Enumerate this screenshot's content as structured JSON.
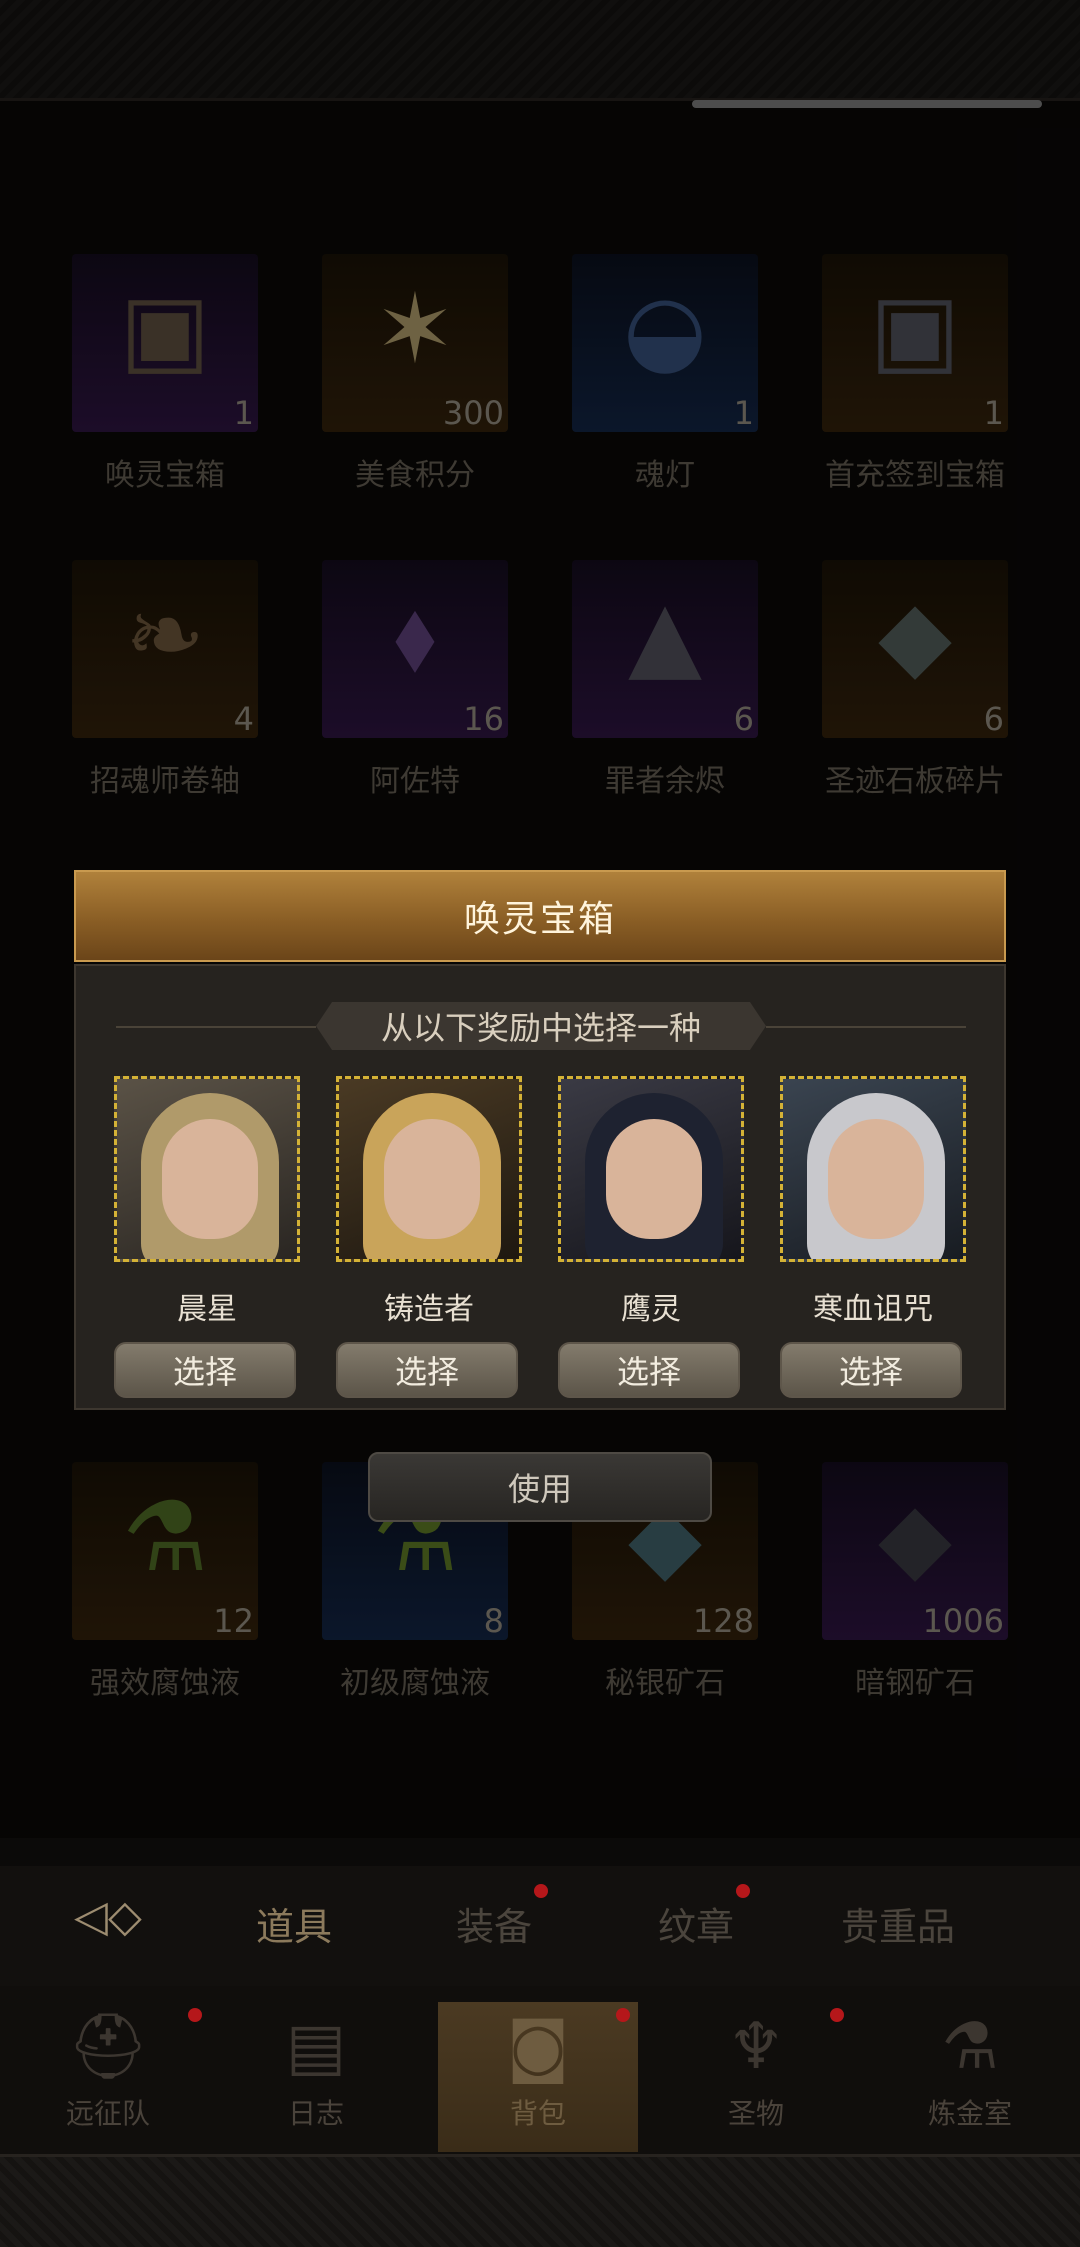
{
  "inventory": {
    "row1": [
      {
        "name": "唤灵宝箱",
        "count": "1",
        "rarity": "purple",
        "icon": "chest-icon"
      },
      {
        "name": "美食积分",
        "count": "300",
        "rarity": "orange",
        "icon": "star-icon"
      },
      {
        "name": "魂灯",
        "count": "1",
        "rarity": "blue",
        "icon": "lamp-icon"
      },
      {
        "name": "首充签到宝箱",
        "count": "1",
        "rarity": "orange",
        "icon": "chest-icon"
      }
    ],
    "row2": [
      {
        "name": "招魂师卷轴",
        "count": "4",
        "rarity": "orange",
        "icon": "scroll-icon"
      },
      {
        "name": "阿佐特",
        "count": "16",
        "rarity": "purple",
        "icon": "crystal-icon"
      },
      {
        "name": "罪者余烬",
        "count": "6",
        "rarity": "purple",
        "icon": "ember-icon"
      },
      {
        "name": "圣迹石板碎片",
        "count": "6",
        "rarity": "orange",
        "icon": "stone-icon"
      }
    ],
    "row3": [
      {
        "name": "强效腐蚀液",
        "count": "12",
        "rarity": "orange",
        "icon": "potion-icon"
      },
      {
        "name": "初级腐蚀液",
        "count": "8",
        "rarity": "blue",
        "icon": "potion-icon"
      },
      {
        "name": "秘银矿石",
        "count": "128",
        "rarity": "orange",
        "icon": "ore-icon"
      },
      {
        "name": "暗钢矿石",
        "count": "1006",
        "rarity": "purple",
        "icon": "ore-icon"
      }
    ]
  },
  "modal": {
    "title": "唤灵宝箱",
    "subtitle": "从以下奖励中选择一种",
    "choices": [
      {
        "name": "晨星",
        "button": "选择"
      },
      {
        "name": "铸造者",
        "button": "选择"
      },
      {
        "name": "鹰灵",
        "button": "选择"
      },
      {
        "name": "寒血诅咒",
        "button": "选择"
      }
    ]
  },
  "use_button": "使用",
  "tabs": {
    "items": [
      {
        "label": "道具",
        "active": true,
        "badge": false
      },
      {
        "label": "装备",
        "active": false,
        "badge": true
      },
      {
        "label": "纹章",
        "active": false,
        "badge": true
      },
      {
        "label": "贵重品",
        "active": false,
        "badge": false
      }
    ]
  },
  "bottom_nav": {
    "items": [
      {
        "label": "远征队",
        "icon": "helmet-icon",
        "badge": true
      },
      {
        "label": "日志",
        "icon": "map-icon",
        "badge": false
      },
      {
        "label": "背包",
        "icon": "bag-icon",
        "badge": true,
        "active": true
      },
      {
        "label": "圣物",
        "icon": "torch-icon",
        "badge": true
      },
      {
        "label": "炼金室",
        "icon": "alchemy-icon",
        "badge": false
      }
    ]
  },
  "colors": {
    "accent_gold": "#d4b236",
    "header_bronze": "#a87a36",
    "badge_red": "#b5171a"
  }
}
